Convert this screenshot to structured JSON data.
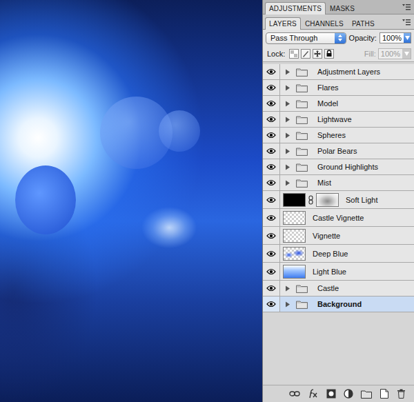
{
  "top_tabs": [
    {
      "label": "ADJUSTMENTS",
      "selected": true
    },
    {
      "label": "MASKS",
      "selected": false
    }
  ],
  "tabs": [
    {
      "label": "LAYERS",
      "selected": true
    },
    {
      "label": "CHANNELS",
      "selected": false
    },
    {
      "label": "PATHS",
      "selected": false
    }
  ],
  "blend_mode": "Pass Through",
  "opacity": {
    "label": "Opacity:",
    "value": "100%"
  },
  "lock": {
    "label": "Lock:"
  },
  "fill": {
    "label": "Fill:",
    "value": "100%",
    "disabled": true
  },
  "layers": [
    {
      "name": "Adjustment Layers",
      "kind": "group",
      "visible": true,
      "expanded": false,
      "selected": false
    },
    {
      "name": "Flares",
      "kind": "group",
      "visible": true,
      "expanded": false,
      "selected": false
    },
    {
      "name": "Model",
      "kind": "group",
      "visible": true,
      "expanded": false,
      "selected": false
    },
    {
      "name": "Lightwave",
      "kind": "group",
      "visible": true,
      "expanded": false,
      "selected": false
    },
    {
      "name": "Spheres",
      "kind": "group",
      "visible": true,
      "expanded": false,
      "selected": false
    },
    {
      "name": "Polar Bears",
      "kind": "group",
      "visible": true,
      "expanded": false,
      "selected": false
    },
    {
      "name": "Ground Highlights",
      "kind": "group",
      "visible": true,
      "expanded": false,
      "selected": false
    },
    {
      "name": "Mist",
      "kind": "group",
      "visible": true,
      "expanded": false,
      "selected": false
    },
    {
      "name": "Soft Light",
      "kind": "adjustment",
      "visible": true,
      "expanded": false,
      "selected": false
    },
    {
      "name": "Castle Vignette",
      "kind": "transparent",
      "visible": true,
      "expanded": false,
      "selected": false
    },
    {
      "name": "Vignette",
      "kind": "transparent",
      "visible": true,
      "expanded": false,
      "selected": false
    },
    {
      "name": "Deep Blue",
      "kind": "spot",
      "visible": true,
      "expanded": false,
      "selected": false
    },
    {
      "name": "Light Blue",
      "kind": "gradient",
      "visible": true,
      "expanded": false,
      "selected": false
    },
    {
      "name": "Castle",
      "kind": "group",
      "visible": true,
      "expanded": false,
      "selected": false
    },
    {
      "name": "Background",
      "kind": "group",
      "visible": true,
      "expanded": false,
      "selected": true
    }
  ]
}
